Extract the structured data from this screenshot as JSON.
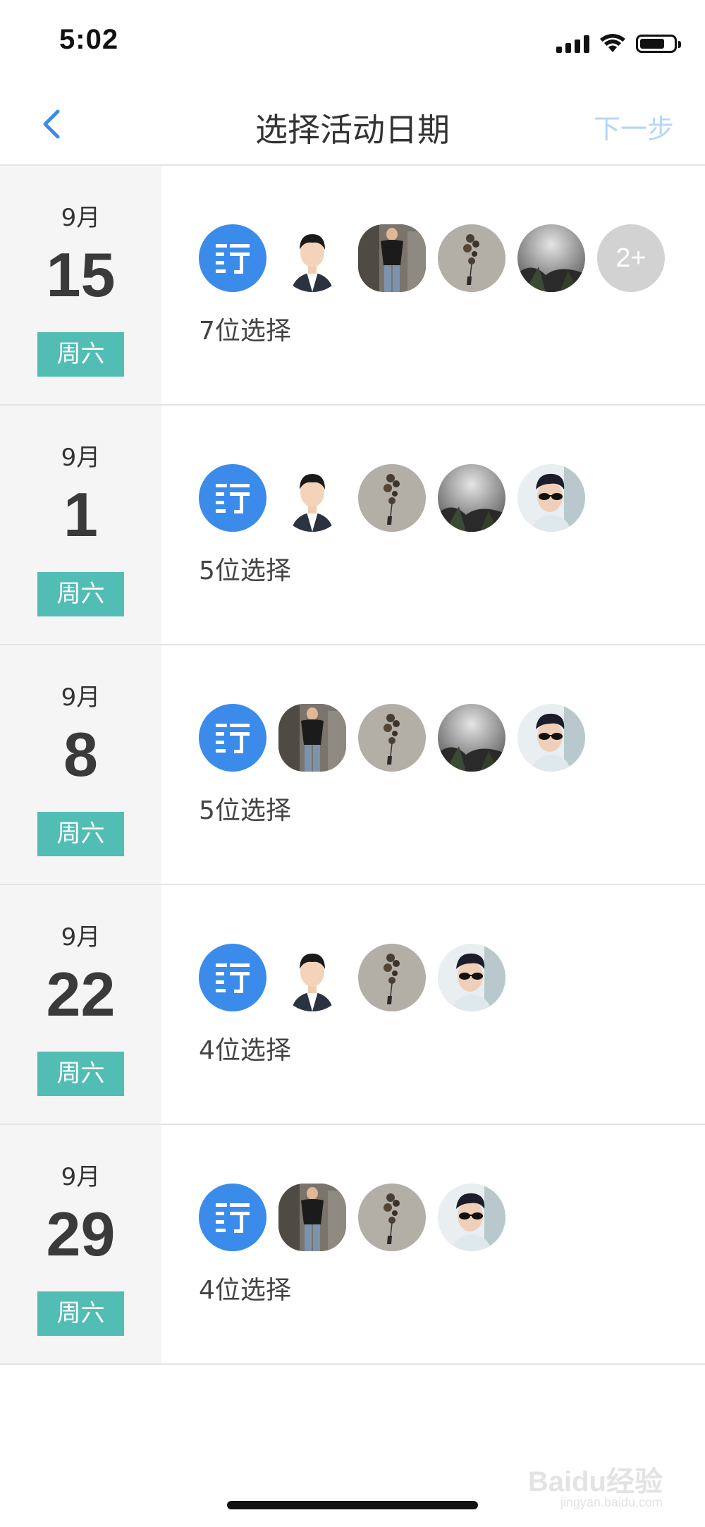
{
  "status_bar": {
    "time": "5:02"
  },
  "nav": {
    "title": "选择活动日期",
    "next_label": "下一步",
    "back_icon": "chevron-left-icon",
    "accent_color": "#3b8bea",
    "next_color": "#b7d6f6"
  },
  "colors": {
    "weekday_badge": "#52bdb5",
    "date_column_bg": "#f5f5f5"
  },
  "dates": [
    {
      "month": "9月",
      "day": "15",
      "weekday": "周六",
      "avatars": [
        "app-logo",
        "person-portrait",
        "person-standing",
        "stones-balloon",
        "misty-forest"
      ],
      "more_label": "2+",
      "count_label": "7位选择"
    },
    {
      "month": "9月",
      "day": "1",
      "weekday": "周六",
      "avatars": [
        "app-logo",
        "person-portrait",
        "stones-balloon",
        "misty-forest",
        "person-sunglasses"
      ],
      "count_label": "5位选择"
    },
    {
      "month": "9月",
      "day": "8",
      "weekday": "周六",
      "avatars": [
        "app-logo",
        "person-standing",
        "stones-balloon",
        "misty-forest",
        "person-sunglasses"
      ],
      "count_label": "5位选择"
    },
    {
      "month": "9月",
      "day": "22",
      "weekday": "周六",
      "avatars": [
        "app-logo",
        "person-portrait",
        "stones-balloon",
        "person-sunglasses"
      ],
      "count_label": "4位选择"
    },
    {
      "month": "9月",
      "day": "29",
      "weekday": "周六",
      "avatars": [
        "app-logo",
        "person-standing",
        "stones-balloon",
        "person-sunglasses"
      ],
      "count_label": "4位选择"
    }
  ],
  "watermark": {
    "text": "Baidu经验",
    "sub": "jingyan.baidu.com"
  }
}
